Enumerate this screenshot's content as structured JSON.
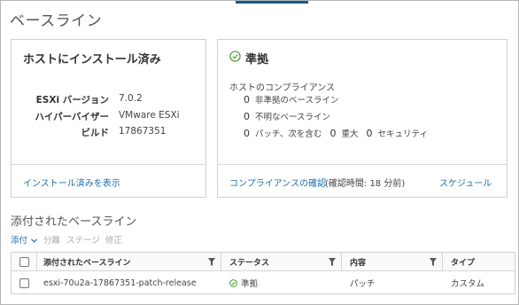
{
  "page": {
    "title": "ベースライン"
  },
  "installed_card": {
    "title": "ホストにインストール済み",
    "rows": [
      {
        "key": "ESXi バージョン",
        "value": "7.0.2"
      },
      {
        "key": "ハイパーバイザー",
        "value": "VMware ESXi"
      },
      {
        "key": "ビルド",
        "value": "17867351"
      }
    ],
    "link": "インストール済みを表示"
  },
  "compliance_card": {
    "status_icon": "check-circle-icon",
    "title": "準拠",
    "heading": "ホストのコンプライアンス",
    "items": [
      {
        "count": "0",
        "label": "非準拠のベースライン"
      },
      {
        "count": "0",
        "label": "不明なベースライン"
      }
    ],
    "patch_line": {
      "count1": "0",
      "label1": "パッチ、次を含む",
      "count2": "0",
      "label2": "重大",
      "count3": "0",
      "label3": "セキュリティ"
    },
    "check_link": "コンプライアンスの確認",
    "check_note": "(確認時間: 18 分前)",
    "schedule_link": "スケジュール"
  },
  "attached": {
    "title": "添付されたベースライン",
    "toolbar": {
      "attach": "添付",
      "detach": "分離",
      "stage": "ステージ",
      "remediate": "修正"
    },
    "columns": [
      "添付されたベースライン",
      "ステータス",
      "内容",
      "タイプ"
    ],
    "rows": [
      {
        "name": "esxi-70u2a-17867351-patch-release",
        "status": "準拠",
        "content": "パッチ",
        "type": "カスタム"
      }
    ]
  },
  "colors": {
    "link": "#1a6fb0",
    "ok_green": "#4c9e3a",
    "accent": "#1a5b8c"
  }
}
